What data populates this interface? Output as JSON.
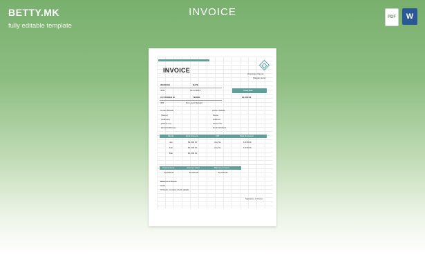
{
  "brand": {
    "logo": "BETTY.MK",
    "tagline": "fully editable template"
  },
  "page": {
    "title": "INVOICE"
  },
  "file_icons": {
    "pdf": "PDF",
    "word": "W"
  },
  "document": {
    "title": "INVOICE",
    "company_name": "[Company Name]",
    "slogan": "[Slogan Here]",
    "invoice_label": "INVOICE#",
    "invoice_value": "4551",
    "date_label": "DATE",
    "date_value": "31-12-2019",
    "customer_label": "CUSTOMER ID",
    "customer_value": "495",
    "terms_label": "TERMS",
    "terms_value": "Due upon Receipt",
    "total_due_label": "Total Due",
    "total_due_value": "$1,300.00",
    "tenant_header": "Tenant Details",
    "tenant_lines": [
      "[Name]",
      "[Address]",
      "[Phone no]",
      "[Email Address]"
    ],
    "owner_header": "Owner Details",
    "owner_lines": [
      "Name",
      "Address",
      "Phone No",
      "Email Address"
    ],
    "rent_headers": [
      "Month",
      "Rent Amount",
      "VAT",
      "Date Received"
    ],
    "rent_rows": [
      [
        "Jan",
        "$1,300.00",
        "Any No",
        "1/1/2019"
      ],
      [
        "Feb",
        "$1,300.00",
        "Any No",
        "1/1/2019"
      ],
      [
        "Mar",
        "$1,300.00",
        "",
        ""
      ]
    ],
    "summary_headers": [
      "Total Amount",
      "Advance Paid",
      "Balance Amount"
    ],
    "summary_values": [
      "$4,000.00",
      "$2,000.00",
      "$2,000.00"
    ],
    "method_header": "Method of Prints",
    "method_lines": [
      "Cash",
      "If Check, mention check details"
    ],
    "signature": "Signature of Owner"
  }
}
